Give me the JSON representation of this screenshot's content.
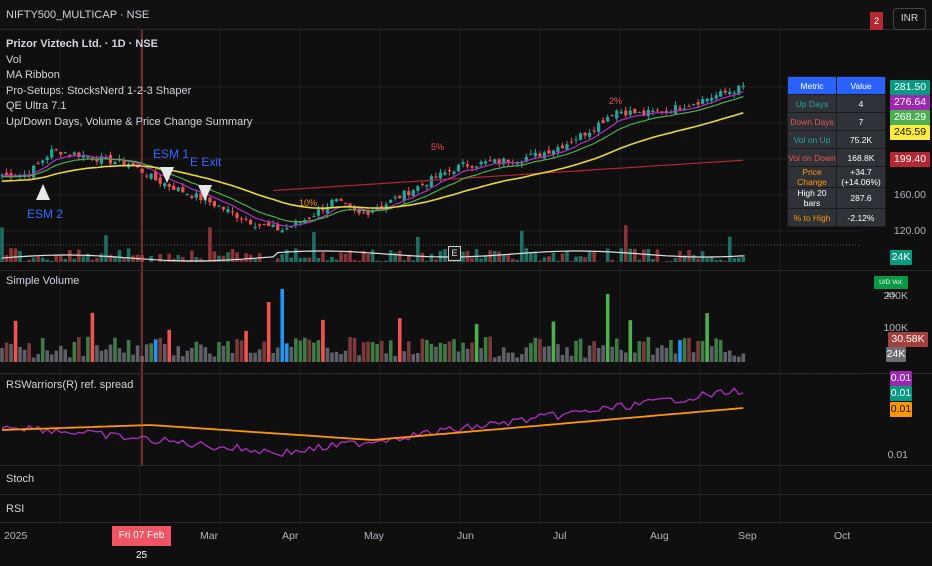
{
  "symbol_bar": "NIFTY500_MULTICAP · NSE",
  "currency": "INR",
  "alert_badge": "2",
  "legend": [
    "Prizor Viztech Ltd. · 1D · NSE",
    "Vol",
    "MA Ribbon",
    "Pro-Setups: StocksNerd 1-2-3 Shaper",
    "QE Ultra 7.1",
    "Up/Down Days, Volume & Price Change Summary"
  ],
  "metrics": {
    "headers": [
      "Metric",
      "Value"
    ],
    "rows": [
      {
        "label": "Up Days",
        "value": "4",
        "color": "#26a69a"
      },
      {
        "label": "Down Days",
        "value": "7",
        "color": "#ef5350"
      },
      {
        "label": "Vol on Up",
        "value": "75.2K",
        "color": "#26a69a"
      },
      {
        "label": "Vol on Down",
        "value": "168.8K",
        "color": "#ef5350"
      },
      {
        "label": "Price Change",
        "value": "+34.7 (+14.06%)",
        "color": "#ff9800"
      },
      {
        "label": "High 20 bars",
        "value": "287.6",
        "color": "#ffffff"
      },
      {
        "label": "% to High",
        "value": "-2.12%",
        "color": "#ff9800"
      }
    ]
  },
  "price_labels": {
    "last": "281.50",
    "ma1": "276.64",
    "ma2": "268.29",
    "ma3": "245.59",
    "ma4": "199.40",
    "vol": "24K"
  },
  "price_axis": [
    "160.00",
    "120.00"
  ],
  "annotations": {
    "esm2": "ESM 2",
    "esm1": "ESM 1",
    "exit": "E Exit",
    "p10": "10%",
    "p5": "5%",
    "p2": "2%",
    "earnings": "E"
  },
  "volume_pane": {
    "title": "Simple Volume",
    "badge": "U/D Vol: 2.5",
    "axis": [
      "200K",
      "100K"
    ],
    "last": "30.58K",
    "avg": "24K"
  },
  "rs_pane": {
    "title": "RSWarriors(R) ref. spread",
    "labels": [
      "0.01",
      "0.01",
      "0.01"
    ],
    "axis": "0.01"
  },
  "stoch_title": "Stoch",
  "rsi_title": "RSI",
  "time_axis": {
    "labels": [
      "2025",
      "Mar",
      "Apr",
      "May",
      "Jun",
      "Jul",
      "Aug",
      "Sep",
      "Oct"
    ],
    "cursor": "Fri 07 Feb 25"
  },
  "price_path": [
    182,
    183,
    210,
    205,
    199,
    195,
    177,
    165,
    154,
    140,
    127,
    121,
    135,
    154,
    138,
    150,
    165,
    180,
    193,
    196,
    199,
    205,
    216,
    232,
    254,
    250,
    254,
    262,
    271,
    280
  ],
  "colors": {
    "up": "#26a69a",
    "down": "#ef5350",
    "ma1": "#b02fc7",
    "ma2": "#4caf50",
    "ma3": "#e6d83a",
    "ma4": "#b22833",
    "rs": "#b02fc7",
    "rs_ma": "#ff9800",
    "cursor": "#d0453f"
  }
}
